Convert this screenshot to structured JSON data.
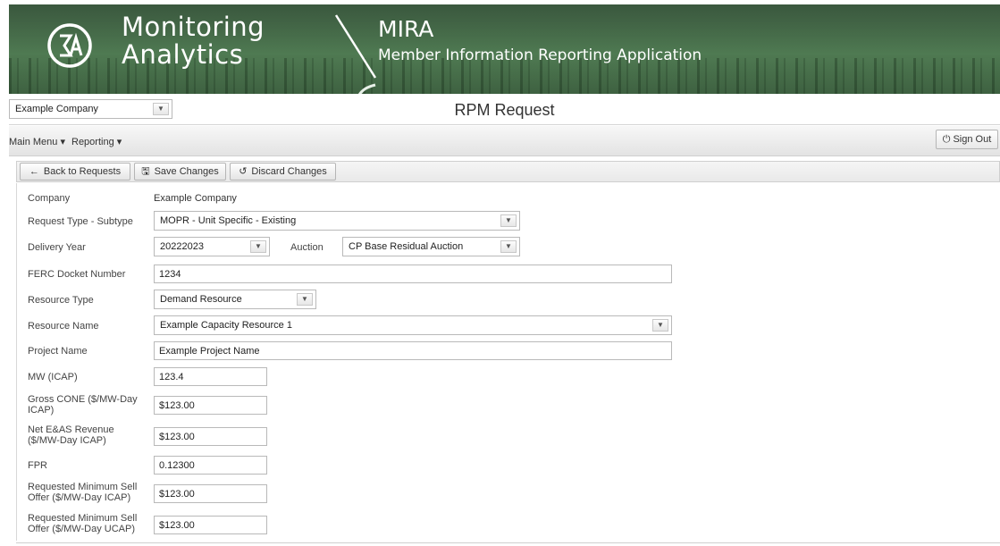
{
  "banner": {
    "brand_line1": "Monitoring",
    "brand_line2": "Analytics",
    "app_title": "MIRA",
    "app_subtitle": "Member Information Reporting Application"
  },
  "company_bar": {
    "company_select": "Example Company",
    "page_title": "RPM Request"
  },
  "menu": {
    "main_menu": "Main Menu ▾",
    "reporting": "Reporting ▾",
    "sign_out": "Sign Out"
  },
  "toolbar": {
    "back": "Back to Requests",
    "save": "Save Changes",
    "discard": "Discard Changes"
  },
  "form": {
    "company_label": "Company",
    "company_value": "Example Company",
    "request_type_label": "Request Type - Subtype",
    "request_type_value": "MOPR - Unit Specific - Existing",
    "delivery_year_label": "Delivery Year",
    "delivery_year_value": "20222023",
    "auction_label": "Auction",
    "auction_value": "CP Base Residual Auction",
    "ferc_label": "FERC Docket Number",
    "ferc_value": "1234",
    "resource_type_label": "Resource Type",
    "resource_type_value": "Demand Resource",
    "resource_name_label": "Resource Name",
    "resource_name_value": "Example Capacity Resource 1",
    "project_name_label": "Project Name",
    "project_name_value": "Example Project Name",
    "mw_label": "MW (ICAP)",
    "mw_value": "123.4",
    "gross_cone_label_1": "Gross CONE ($/MW-Day",
    "gross_cone_label_2": "ICAP)",
    "gross_cone_value": "$123.00",
    "net_eas_label_1": "Net E&AS Revenue",
    "net_eas_label_2": "($/MW-Day ICAP)",
    "net_eas_value": "$123.00",
    "fpr_label": "FPR",
    "fpr_value": "0.12300",
    "req_min_icap_label_1": "Requested Minimum Sell",
    "req_min_icap_label_2": "Offer ($/MW-Day ICAP)",
    "req_min_icap_value": "$123.00",
    "req_min_ucap_label_1": "Requested Minimum Sell",
    "req_min_ucap_label_2": "Offer ($/MW-Day UCAP)",
    "req_min_ucap_value": "$123.00"
  },
  "icons": {
    "back": "arrow-left-icon",
    "save": "floppy-disk-icon",
    "discard": "undo-icon",
    "sign_out": "power-icon",
    "dropdown": "caret-down-icon"
  }
}
